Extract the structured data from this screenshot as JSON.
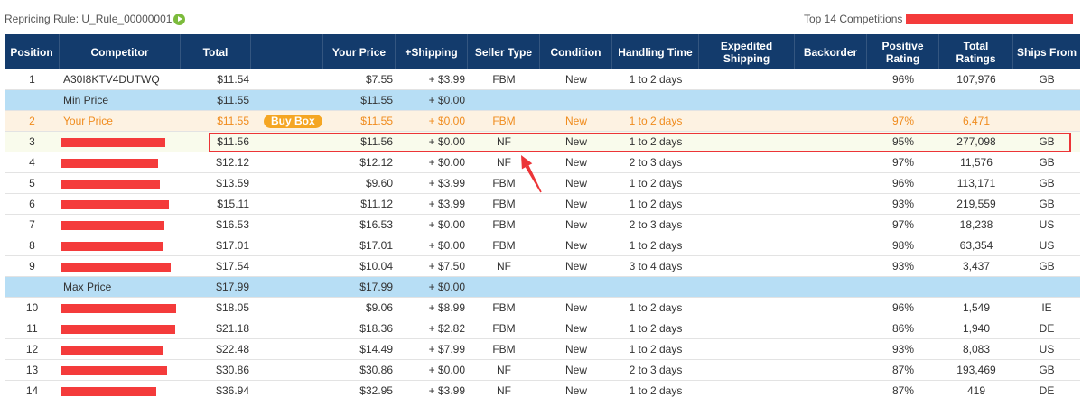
{
  "rule_label": "Repricing Rule: U_Rule_00000001",
  "competitions_label": "Top 14 Competitions",
  "icons": {
    "rule_action": "play-icon"
  },
  "colors": {
    "header_bg": "#133b6c",
    "band_bg": "#b7def5",
    "accent": "#f08c1e",
    "own_row_bg": "#fdf2e2",
    "highlight_row_bg": "#f9fbec",
    "badge_bg": "#f5a623",
    "annotation": "#ec3437",
    "redaction": "#f43b3b",
    "play_icon": "#7cbb3c"
  },
  "columns": [
    "Position",
    "Competitor",
    "Total",
    "",
    "Your Price",
    "+Shipping",
    "Seller Type",
    "Condition",
    "Handling Time",
    "Expedited Shipping",
    "Backorder",
    "Positive Rating",
    "Total Ratings",
    "Ships From"
  ],
  "rows": [
    {
      "position": "1",
      "competitor": "A30I8KTV4DUTWQ",
      "total": "$11.54",
      "your_price": "$7.55",
      "shipping": "+ $3.99",
      "seller_type": "FBM",
      "condition": "New",
      "handling_time": "1 to 2 days",
      "positive_rating": "96%",
      "total_ratings": "107,976",
      "ships_from": "GB"
    },
    {
      "band": true,
      "competitor": "Min Price",
      "total": "$11.55",
      "your_price": "$11.55",
      "shipping": "+ $0.00"
    },
    {
      "own": true,
      "position": "2",
      "competitor": "Your Price",
      "total": "$11.55",
      "badge": "Buy Box",
      "your_price": "$11.55",
      "shipping": "+ $0.00",
      "seller_type": "FBM",
      "condition": "New",
      "handling_time": "1 to 2 days",
      "positive_rating": "97%",
      "total_ratings": "6,471"
    },
    {
      "highlighted": true,
      "redacted": true,
      "position": "3",
      "total": "$11.56",
      "your_price": "$11.56",
      "shipping": "+ $0.00",
      "seller_type": "NF",
      "condition": "New",
      "handling_time": "1 to 2 days",
      "positive_rating": "95%",
      "total_ratings": "277,098",
      "ships_from": "GB"
    },
    {
      "redacted": true,
      "position": "4",
      "total": "$12.12",
      "your_price": "$12.12",
      "shipping": "+ $0.00",
      "seller_type": "NF",
      "condition": "New",
      "handling_time": "2 to 3 days",
      "positive_rating": "97%",
      "total_ratings": "11,576",
      "ships_from": "GB"
    },
    {
      "redacted": true,
      "position": "5",
      "total": "$13.59",
      "your_price": "$9.60",
      "shipping": "+ $3.99",
      "seller_type": "FBM",
      "condition": "New",
      "handling_time": "1 to 2 days",
      "positive_rating": "96%",
      "total_ratings": "113,171",
      "ships_from": "GB"
    },
    {
      "redacted": true,
      "position": "6",
      "total": "$15.11",
      "your_price": "$11.12",
      "shipping": "+ $3.99",
      "seller_type": "FBM",
      "condition": "New",
      "handling_time": "1 to 2 days",
      "positive_rating": "93%",
      "total_ratings": "219,559",
      "ships_from": "GB"
    },
    {
      "redacted": true,
      "position": "7",
      "total": "$16.53",
      "your_price": "$16.53",
      "shipping": "+ $0.00",
      "seller_type": "FBM",
      "condition": "New",
      "handling_time": "2 to 3 days",
      "positive_rating": "97%",
      "total_ratings": "18,238",
      "ships_from": "US"
    },
    {
      "redacted": true,
      "position": "8",
      "total": "$17.01",
      "your_price": "$17.01",
      "shipping": "+ $0.00",
      "seller_type": "FBM",
      "condition": "New",
      "handling_time": "1 to 2 days",
      "positive_rating": "98%",
      "total_ratings": "63,354",
      "ships_from": "US"
    },
    {
      "redacted": true,
      "position": "9",
      "total": "$17.54",
      "your_price": "$10.04",
      "shipping": "+ $7.50",
      "seller_type": "NF",
      "condition": "New",
      "handling_time": "3 to 4 days",
      "positive_rating": "93%",
      "total_ratings": "3,437",
      "ships_from": "GB"
    },
    {
      "band": true,
      "competitor": "Max Price",
      "total": "$17.99",
      "your_price": "$17.99",
      "shipping": "+ $0.00"
    },
    {
      "redacted": true,
      "position": "10",
      "total": "$18.05",
      "your_price": "$9.06",
      "shipping": "+ $8.99",
      "seller_type": "FBM",
      "condition": "New",
      "handling_time": "1 to 2 days",
      "positive_rating": "96%",
      "total_ratings": "1,549",
      "ships_from": "IE"
    },
    {
      "redacted": true,
      "position": "11",
      "total": "$21.18",
      "your_price": "$18.36",
      "shipping": "+ $2.82",
      "seller_type": "FBM",
      "condition": "New",
      "handling_time": "1 to 2 days",
      "positive_rating": "86%",
      "total_ratings": "1,940",
      "ships_from": "DE"
    },
    {
      "redacted": true,
      "position": "12",
      "total": "$22.48",
      "your_price": "$14.49",
      "shipping": "+ $7.99",
      "seller_type": "FBM",
      "condition": "New",
      "handling_time": "1 to 2 days",
      "positive_rating": "93%",
      "total_ratings": "8,083",
      "ships_from": "US"
    },
    {
      "redacted": true,
      "position": "13",
      "total": "$30.86",
      "your_price": "$30.86",
      "shipping": "+ $0.00",
      "seller_type": "NF",
      "condition": "New",
      "handling_time": "2 to 3 days",
      "positive_rating": "87%",
      "total_ratings": "193,469",
      "ships_from": "GB"
    },
    {
      "redacted": true,
      "position": "14",
      "total": "$36.94",
      "your_price": "$32.95",
      "shipping": "+ $3.99",
      "seller_type": "NF",
      "condition": "New",
      "handling_time": "1 to 2 days",
      "positive_rating": "87%",
      "total_ratings": "419",
      "ships_from": "DE"
    }
  ]
}
